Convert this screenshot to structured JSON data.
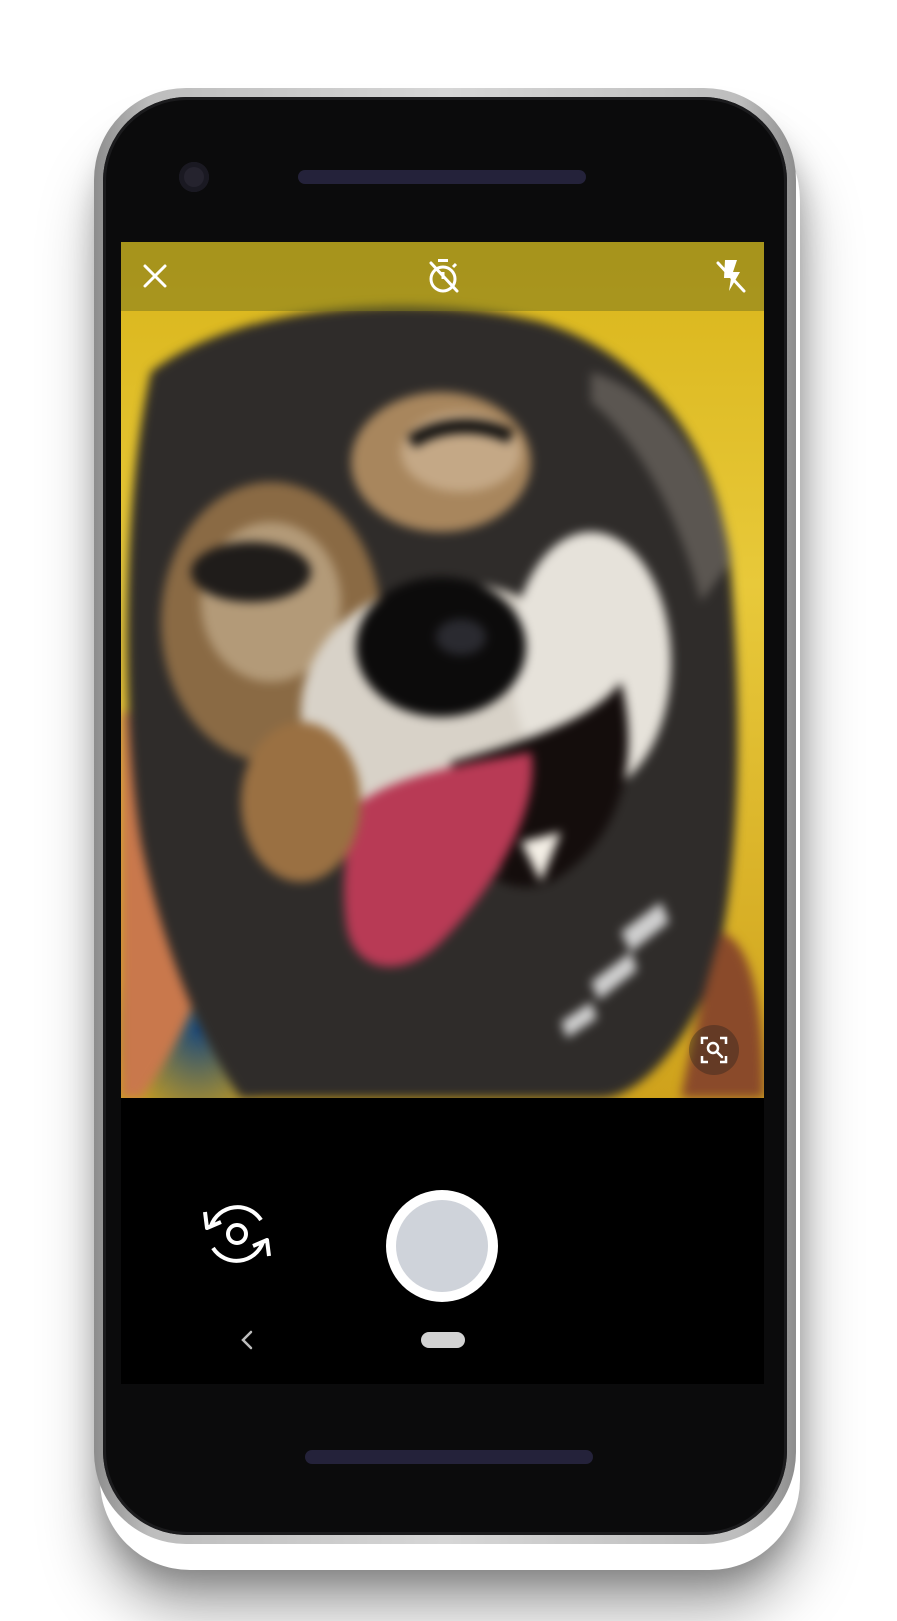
{
  "device": {
    "frame_color": "#c8c8c8",
    "body_color": "#0b0b0c"
  },
  "camera": {
    "top_bar": {
      "close_icon": "close-icon",
      "timer_icon": "timer-off-icon",
      "flash_icon": "flash-off-icon"
    },
    "viewfinder": {
      "subject": "dog",
      "lens_icon": "image-search-icon"
    },
    "controls": {
      "switch_icon": "switch-camera-icon",
      "shutter_color": "#cfd3da"
    },
    "nav": {
      "back_icon": "chevron-left-icon",
      "home_icon": "home-pill-icon"
    }
  }
}
